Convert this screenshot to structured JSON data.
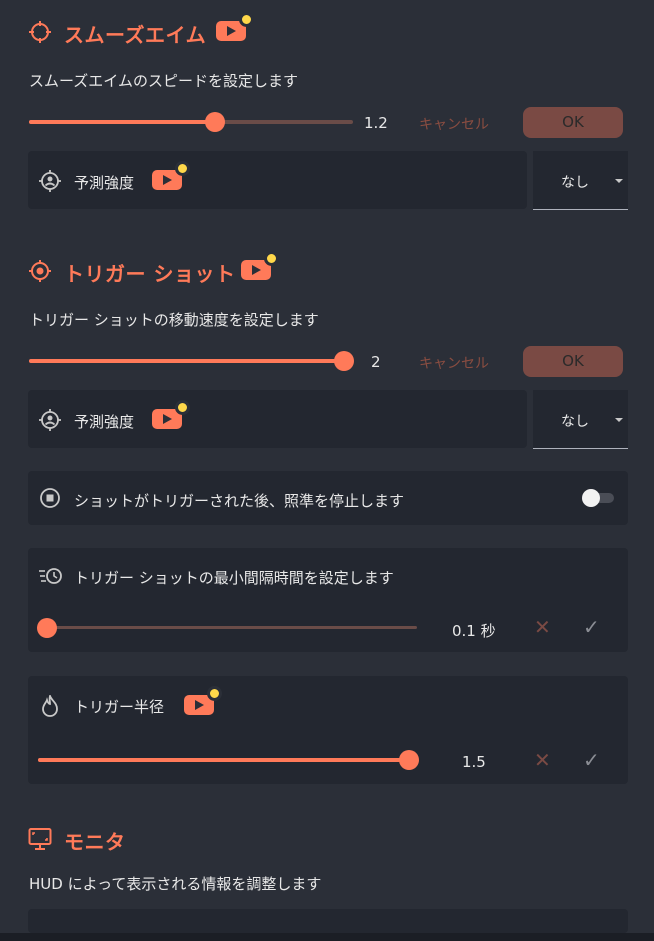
{
  "smooth_aim": {
    "title": "スムーズエイム",
    "description": "スムーズエイムのスピードを設定します",
    "slider_value": "1.2",
    "slider_fraction": 0.58,
    "cancel_label": "キャンセル",
    "ok_label": "OK",
    "prediction_label": "予測強度",
    "prediction_value": "なし"
  },
  "trigger_shot": {
    "title": "トリガー ショット",
    "description": "トリガー ショットの移動速度を設定します",
    "slider_value": "2",
    "slider_fraction": 1.0,
    "cancel_label": "キャンセル",
    "ok_label": "OK",
    "prediction_label": "予測強度",
    "prediction_value": "なし",
    "stop_aim_label": "ショットがトリガーされた後、照準を停止します",
    "stop_aim_enabled": false,
    "min_interval_label": "トリガー ショットの最小間隔時間を設定します",
    "min_interval_value": "0.1 秒",
    "min_interval_fraction": 0.0,
    "radius_label": "トリガー半径",
    "radius_value": "1.5",
    "radius_fraction": 1.0
  },
  "monitor": {
    "title": "モニタ",
    "description": "HUD によって表示される情報を調整します"
  },
  "colors": {
    "accent": "#ff7a59",
    "background": "#2b2f38",
    "panel": "#232730"
  }
}
